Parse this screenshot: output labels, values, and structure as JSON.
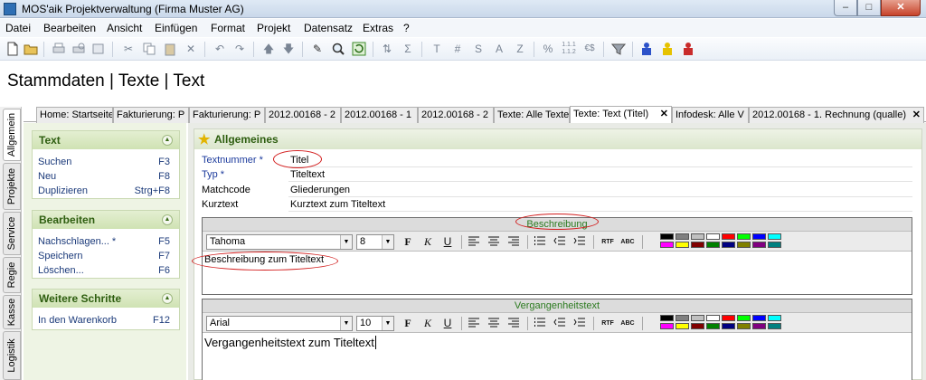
{
  "window": {
    "title": "MOS'aik Projektverwaltung (Firma Muster AG)",
    "minimize": "–",
    "maximize": "□",
    "close": "✕"
  },
  "menu": [
    "Datei",
    "Bearbeiten",
    "Ansicht",
    "Einfügen",
    "Format",
    "Projekt",
    "Datensatz",
    "Extras",
    "?"
  ],
  "toolbar": {
    "buttons": [
      "new-icon",
      "open-icon",
      "print-icon",
      "print-preview-icon",
      "export-icon",
      "cut-icon",
      "copy-icon",
      "paste-icon",
      "delete-icon",
      "undo-icon",
      "redo-icon",
      "up-icon",
      "down-icon",
      "edit-icon",
      "search-icon",
      "refresh-icon",
      "sort-icon",
      "sum-icon",
      "grid-icon",
      "s-icon",
      "a-icon",
      "z-icon",
      "percent-icon",
      "numbers-icon",
      "currency-icon",
      "filter-off-icon",
      "user-blue-icon",
      "user-yellow-icon",
      "user-red-icon"
    ],
    "text_buttons": {
      "t": "T",
      "hash": "#",
      "s": "S",
      "a": "A",
      "z": "Z",
      "percent": "%",
      "numbers": "1.1.1\n1.1.2",
      "currency": "€$"
    }
  },
  "page_title": "Stammdaten | Texte | Text",
  "side_tabs": [
    "Allgemein",
    "Projekte",
    "Service",
    "Regie",
    "Kasse",
    "Logistik"
  ],
  "doc_tabs": [
    {
      "label": "Home: Startseite",
      "active": false
    },
    {
      "label": "Fakturierung: P",
      "active": false
    },
    {
      "label": "Fakturierung: P",
      "active": false
    },
    {
      "label": "2012.00168 - 2",
      "active": false
    },
    {
      "label": "2012.00168 - 1",
      "active": false
    },
    {
      "label": "2012.00168 - 2",
      "active": false
    },
    {
      "label": "Texte: Alle Texte",
      "active": false
    },
    {
      "label": "Texte: Text (Titel)",
      "active": true,
      "close": "✕"
    },
    {
      "label": "Infodesk: Alle V",
      "active": false
    },
    {
      "label": "2012.00168 - 1. Rechnung (qualle)",
      "active": false,
      "close": "✕"
    }
  ],
  "sidebar": {
    "groups": [
      {
        "title": "Text",
        "items": [
          {
            "label": "Suchen",
            "key": "F3"
          },
          {
            "label": "Neu",
            "key": "F8"
          },
          {
            "label": "Duplizieren",
            "key": "Strg+F8"
          }
        ]
      },
      {
        "title": "Bearbeiten",
        "items": [
          {
            "label": "Nachschlagen... *",
            "key": "F5"
          },
          {
            "label": "Speichern",
            "key": "F7"
          },
          {
            "label": "Löschen...",
            "key": "F6"
          }
        ]
      },
      {
        "title": "Weitere Schritte",
        "items": [
          {
            "label": "In den Warenkorb",
            "key": "F12"
          }
        ]
      }
    ],
    "chevron": "▲"
  },
  "main": {
    "section_title": "Allgemeines",
    "fields": [
      {
        "label": "Textnummer *",
        "value": "Titel",
        "required": true
      },
      {
        "label": "Typ *",
        "value": "Titeltext",
        "required": true
      },
      {
        "label": "Matchcode",
        "value": "Gliederungen",
        "required": false
      },
      {
        "label": "Kurztext",
        "value": "Kurztext zum Titeltext",
        "required": false
      }
    ],
    "editors": [
      {
        "title": "Beschreibung",
        "font": "Tahoma",
        "size": "8",
        "body": "Beschreibung zum Titeltext"
      },
      {
        "title": "Vergangenheitstext",
        "font": "Arial",
        "size": "10",
        "body": "Vergangenheitstext zum Titeltext"
      }
    ],
    "format_buttons": {
      "bold": "F",
      "italic": "K",
      "underline": "U",
      "rtf": "RTF",
      "spell": "ABC"
    },
    "colors": [
      "#000000",
      "#808080",
      "#c0c0c0",
      "#ffffff",
      "#ff0000",
      "#00ff00",
      "#0000ff",
      "#00ffff",
      "#ff00ff",
      "#ffff00",
      "#800000",
      "#008000",
      "#000080",
      "#808000",
      "#800080",
      "#008080"
    ]
  },
  "accent_colors": {
    "sidebar_link": "#1b3a7a",
    "group_title": "#2e5e10",
    "annotation": "#d21d1d"
  }
}
